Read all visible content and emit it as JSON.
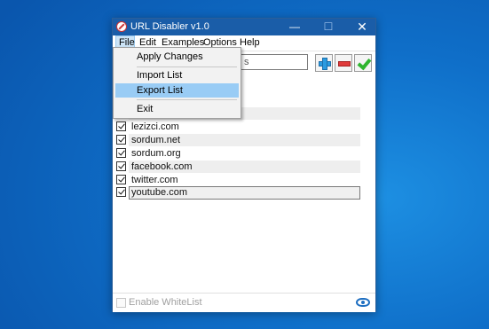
{
  "window": {
    "title": "URL Disabler v1.0",
    "minimize": "—",
    "maximize": "☐",
    "close": "✕"
  },
  "menubar": {
    "file": "File",
    "edit": "Edit",
    "examples": "Examples",
    "options": "Options",
    "help": "Help"
  },
  "file_menu": {
    "items": [
      "Apply Changes",
      "Import List",
      "Export List",
      "Exit"
    ],
    "highlighted": "Export List"
  },
  "url_input": {
    "value": "s"
  },
  "url_list": {
    "items": [
      {
        "label": "",
        "checked": true
      },
      {
        "label": "lezizci.com",
        "checked": true
      },
      {
        "label": "sordum.net",
        "checked": true
      },
      {
        "label": "sordum.org",
        "checked": true
      },
      {
        "label": "facebook.com",
        "checked": true
      },
      {
        "label": "twitter.com",
        "checked": true
      },
      {
        "label": "youtube.com",
        "checked": true
      }
    ],
    "selected": "youtube.com"
  },
  "statusbar": {
    "whitelist_label": "Enable WhiteList",
    "whitelist_enabled": false
  },
  "colors": {
    "titlebar": "#1a5da8",
    "menu_highlight": "#99ccf5",
    "add_icon": "#2b9be0",
    "remove_icon": "#e03a3a",
    "apply_icon": "#2fb52f",
    "eye_icon": "#1f6fc1"
  }
}
